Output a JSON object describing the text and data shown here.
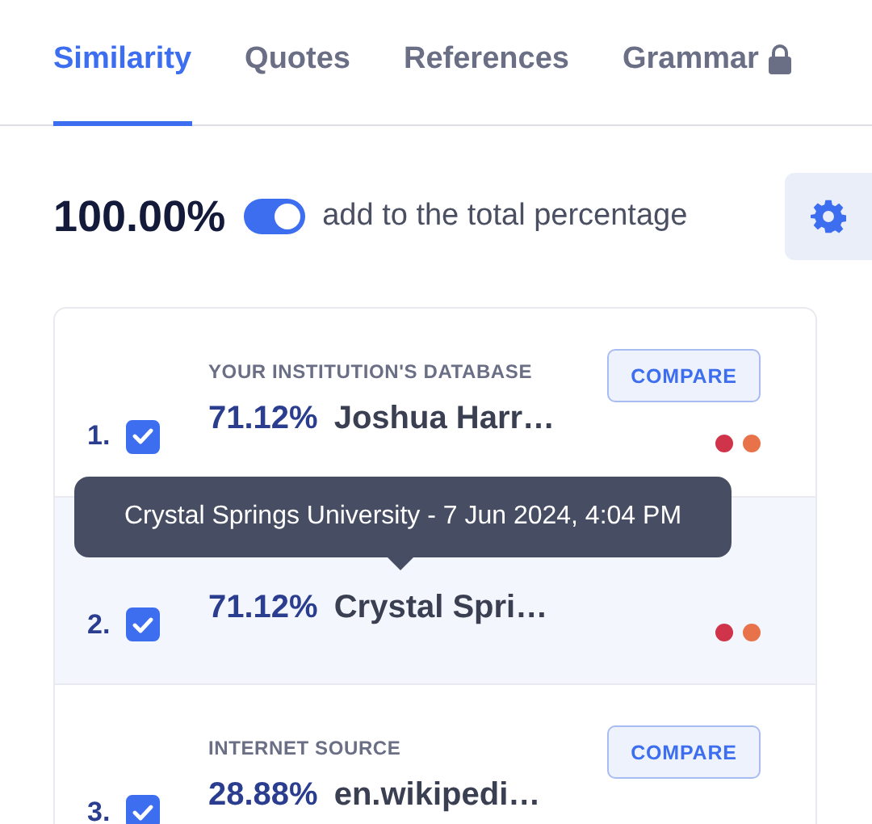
{
  "tabs": [
    {
      "label": "Similarity",
      "selected": true,
      "locked": false
    },
    {
      "label": "Quotes",
      "selected": false,
      "locked": false
    },
    {
      "label": "References",
      "selected": false,
      "locked": false
    },
    {
      "label": "Grammar",
      "selected": false,
      "locked": true
    }
  ],
  "total": {
    "value": "100.00%",
    "toggle_on": true,
    "label": "add to the total percentage"
  },
  "sources": [
    {
      "number": "1.",
      "checked": true,
      "category": "YOUR INSTITUTION'S DATABASE",
      "percent": "71.12%",
      "name": "Joshua Harr…",
      "compare": "COMPARE",
      "highlighted": false,
      "dots": [
        {
          "color": "#d0344a"
        },
        {
          "color": "#e8734a"
        }
      ]
    },
    {
      "number": "2.",
      "checked": true,
      "percent": "71.12%",
      "name": "Crystal Spri…",
      "highlighted": true,
      "dots": [
        {
          "color": "#d0344a"
        },
        {
          "color": "#e8734a"
        }
      ]
    },
    {
      "number": "3.",
      "checked": true,
      "category": "INTERNET SOURCE",
      "percent": "28.88%",
      "name": "en.wikipedi…",
      "compare": "COMPARE",
      "highlighted": false
    }
  ],
  "tooltip": "Crystal Springs University - 7 Jun 2024, 4:04 PM"
}
